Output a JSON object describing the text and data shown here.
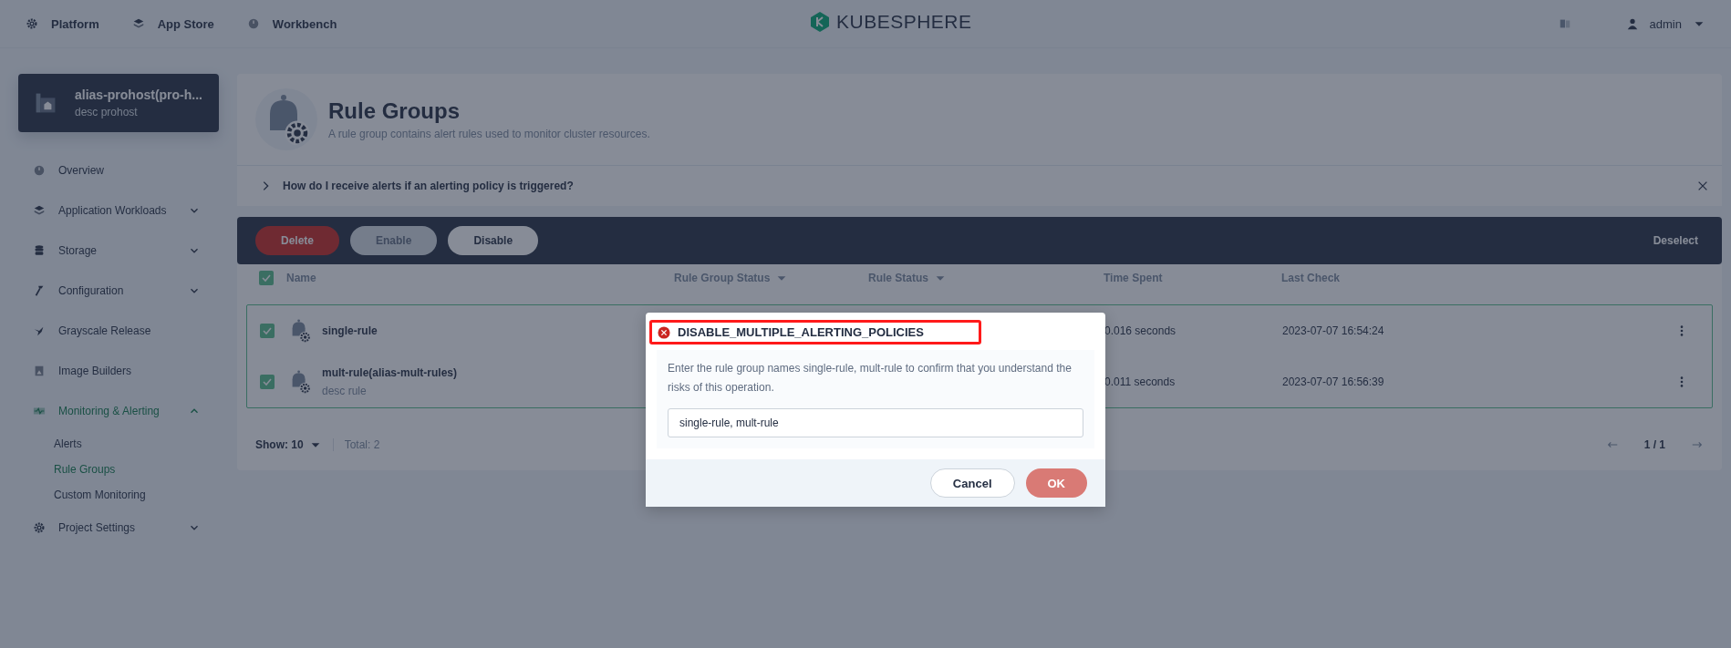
{
  "top_nav": {
    "items": [
      {
        "label": "Platform",
        "kind": "gear"
      },
      {
        "label": "App Store",
        "kind": "layers"
      },
      {
        "label": "Workbench",
        "kind": "dial"
      }
    ],
    "logo": "KUBESPHERE",
    "user": "admin"
  },
  "sidebar": {
    "project": {
      "name": "alias-prohost(pro-h...",
      "description": "desc prohost"
    },
    "items": [
      {
        "label": "Overview",
        "kind": "link"
      },
      {
        "label": "Application Workloads",
        "kind": "group",
        "expanded": false
      },
      {
        "label": "Storage",
        "kind": "group",
        "expanded": false
      },
      {
        "label": "Configuration",
        "kind": "group",
        "expanded": false
      },
      {
        "label": "Grayscale Release",
        "kind": "link"
      },
      {
        "label": "Image Builders",
        "kind": "link"
      },
      {
        "label": "Monitoring & Alerting",
        "kind": "group",
        "expanded": true,
        "selected": true,
        "children": [
          {
            "label": "Alerts",
            "selected": false
          },
          {
            "label": "Rule Groups",
            "selected": true
          },
          {
            "label": "Custom Monitoring",
            "selected": false
          }
        ]
      },
      {
        "label": "Project Settings",
        "kind": "group",
        "expanded": false
      }
    ]
  },
  "header": {
    "title": "Rule Groups",
    "description": "A rule group contains alert rules used to monitor cluster resources."
  },
  "banner": {
    "question": "How do I receive alerts if an alerting policy is triggered?"
  },
  "toolbar": {
    "buttons": [
      {
        "label": "Delete",
        "kind": "danger",
        "disabled": false
      },
      {
        "label": "Enable",
        "kind": "default",
        "disabled": true
      },
      {
        "label": "Disable",
        "kind": "default",
        "disabled": false
      }
    ],
    "deselect": "Deselect"
  },
  "table": {
    "all_selected": true,
    "columns": [
      {
        "label": "Name",
        "sortable": false
      },
      {
        "label": "Rule Group Status",
        "sortable": true
      },
      {
        "label": "Rule Status",
        "sortable": true
      },
      {
        "label": "Time Spent",
        "sortable": false
      },
      {
        "label": "Last Check",
        "sortable": false
      }
    ],
    "rows": [
      {
        "selected": true,
        "name": "single-rule",
        "time_spent": "0.016 seconds",
        "last_check": "2023-07-07 16:54:24"
      },
      {
        "selected": true,
        "name": "mult-rule(alias-mult-rules)",
        "description": "desc rule",
        "time_spent": "0.011 seconds",
        "last_check": "2023-07-07 16:56:39"
      }
    ]
  },
  "footer": {
    "page_size": "Show: 10",
    "total": "Total: 2",
    "page": "1 / 1"
  },
  "dialog": {
    "title": "DISABLE_MULTIPLE_ALERTING_POLICIES",
    "highlighted": true,
    "message": "Enter the rule group names single-rule, mult-rule to confirm that you understand the risks of this operation.",
    "value": "single-rule, mult-rule",
    "buttons": [
      {
        "label": "Cancel",
        "kind": "default"
      },
      {
        "label": "OK",
        "kind": "primary"
      }
    ]
  }
}
